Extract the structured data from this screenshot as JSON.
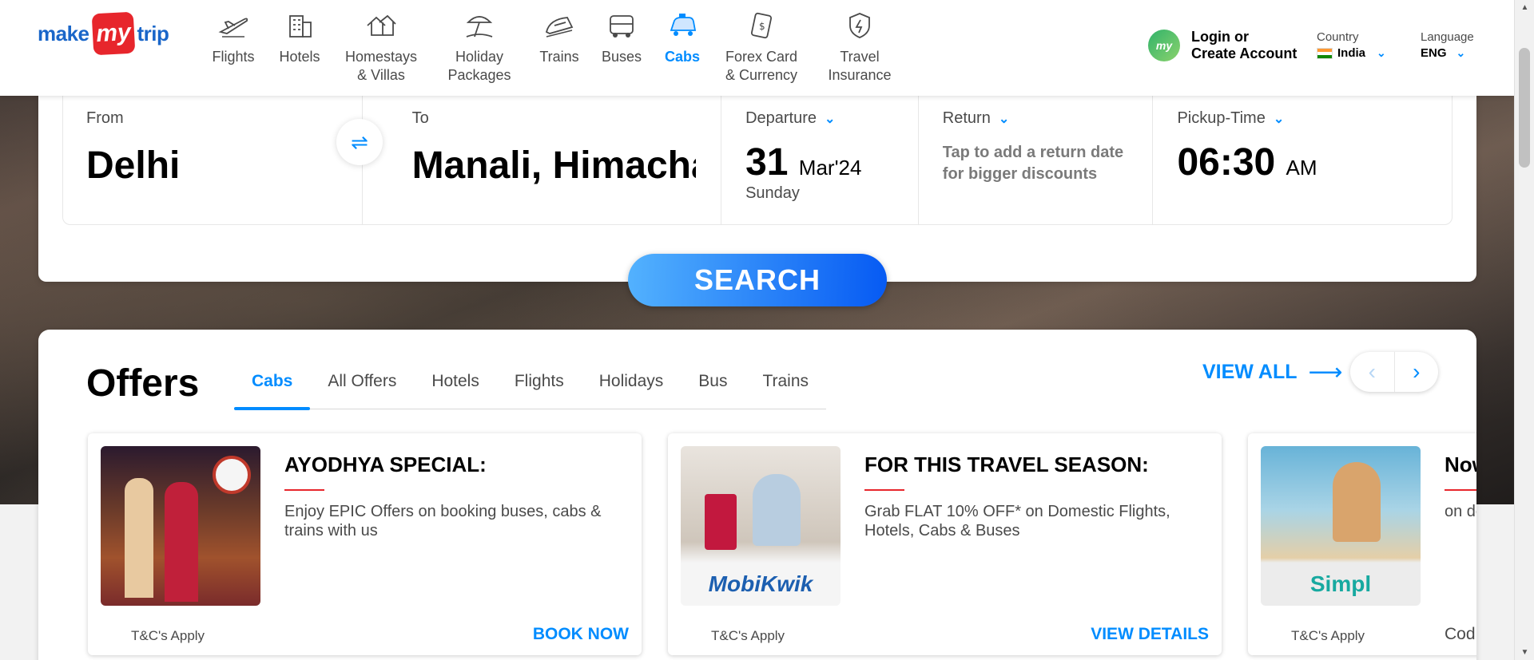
{
  "header": {
    "logo": {
      "make": "make",
      "my": "my",
      "trip": "trip"
    },
    "nav": [
      {
        "label": "Flights",
        "icon": "flight-icon",
        "active": false
      },
      {
        "label": "Hotels",
        "icon": "hotel-icon",
        "active": false
      },
      {
        "label": "Homestays\n& Villas",
        "icon": "homestay-icon",
        "active": false
      },
      {
        "label": "Holiday\nPackages",
        "icon": "holiday-icon",
        "active": false
      },
      {
        "label": "Trains",
        "icon": "train-icon",
        "active": false
      },
      {
        "label": "Buses",
        "icon": "bus-icon",
        "active": false
      },
      {
        "label": "Cabs",
        "icon": "cab-icon",
        "active": true
      },
      {
        "label": "Forex Card\n& Currency",
        "icon": "forex-icon",
        "active": false
      },
      {
        "label": "Travel\nInsurance",
        "icon": "insurance-icon",
        "active": false
      }
    ],
    "login": {
      "line1": "Login or",
      "line2": "Create Account",
      "avatar_text": "my"
    },
    "country": {
      "caption": "Country",
      "value": "India"
    },
    "language": {
      "caption": "Language",
      "value": "ENG"
    }
  },
  "search": {
    "from": {
      "label": "From",
      "value": "Delhi"
    },
    "to": {
      "label": "To",
      "value": "Manali, Himachal Pradesh"
    },
    "departure": {
      "label": "Departure",
      "day_num": "31",
      "month_year": "Mar'24",
      "weekday": "Sunday"
    },
    "return": {
      "label": "Return",
      "hint": "Tap to add a return date for bigger discounts"
    },
    "pickup": {
      "label": "Pickup-Time",
      "time": "06:30",
      "ampm": "AM"
    },
    "button": "SEARCH"
  },
  "offers": {
    "title": "Offers",
    "tabs": [
      "Cabs",
      "All Offers",
      "Hotels",
      "Flights",
      "Holidays",
      "Bus",
      "Trains"
    ],
    "active_tab": "Cabs",
    "view_all": "VIEW ALL",
    "cards": [
      {
        "heading": "AYODHYA SPECIAL:",
        "desc": "Enjoy EPIC Offers on booking buses, cabs & trains with us",
        "tc": "T&C's Apply",
        "cta": "BOOK NOW",
        "brand": ""
      },
      {
        "heading": "FOR THIS TRAVEL SEASON:",
        "desc": "Grab FLAT 10% OFF* on Domestic Flights, Hotels, Cabs & Buses",
        "tc": "T&C's Apply",
        "cta": "VIEW DETAILS",
        "brand": "MobiKwik"
      },
      {
        "heading": "Now",
        "desc": "on domestic flights, hotels, cabs",
        "tc": "T&C's Apply",
        "cta": "Cod",
        "brand": "Simpl"
      }
    ]
  },
  "colors": {
    "accent": "#008cff",
    "brand_red": "#e7262c",
    "search_start": "#53b2fe",
    "search_end": "#065af3"
  }
}
